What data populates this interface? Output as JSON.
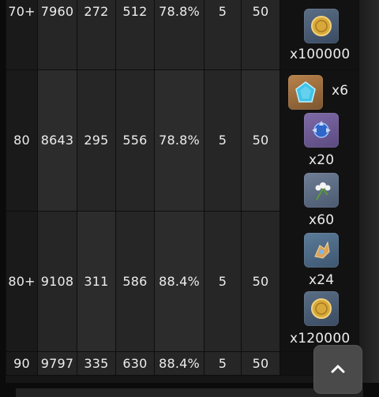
{
  "table": {
    "rows": [
      {
        "level": "70+",
        "hp": "7960",
        "atk": "272",
        "def": "512",
        "bonus": "78.8%",
        "cr": "5",
        "cd": "50"
      },
      {
        "level": "80",
        "hp": "8643",
        "atk": "295",
        "def": "556",
        "bonus": "78.8%",
        "cr": "5",
        "cd": "50"
      },
      {
        "level": "80+",
        "hp": "9108",
        "atk": "311",
        "def": "586",
        "bonus": "88.4%",
        "cr": "5",
        "cd": "50"
      },
      {
        "level": "90",
        "hp": "9797",
        "atk": "335",
        "def": "630",
        "bonus": "88.4%",
        "cr": "5",
        "cd": "50"
      }
    ]
  },
  "materials": {
    "row70plus": [
      {
        "icon": "mora-coin-icon",
        "qty": "x100000"
      }
    ],
    "row80": [],
    "row80plus": [
      {
        "icon": "gemstone-chunk-icon",
        "qty": "x6"
      },
      {
        "icon": "boss-orb-icon",
        "qty": "x20"
      },
      {
        "icon": "local-specialty-flower-icon",
        "qty": "x60"
      },
      {
        "icon": "common-drop-icon",
        "qty": "x24"
      },
      {
        "icon": "mora-coin-icon",
        "qty": "x120000"
      }
    ]
  },
  "scroll_button": {
    "icon": "chevron-up-icon"
  },
  "colors": {
    "background": "#161616",
    "cell": "#262626",
    "button": "#4a4a4a"
  }
}
